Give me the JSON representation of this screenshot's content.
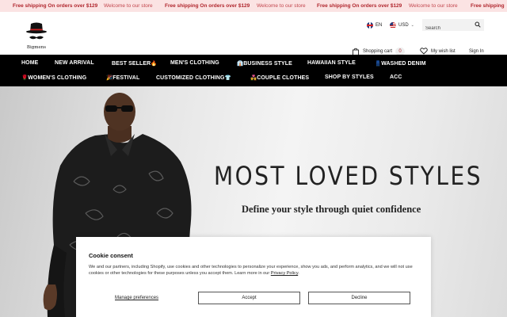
{
  "ticker": {
    "items": [
      {
        "text": "Free shipping On orders over $129",
        "style": "bold"
      },
      {
        "text": "Welcome to our store",
        "style": "light"
      },
      {
        "text": "Free shipping On orders over $129",
        "style": "bold"
      },
      {
        "text": "Welcome to our store",
        "style": "light"
      },
      {
        "text": "Free shipping On orders over $129",
        "style": "bold"
      },
      {
        "text": "Welcome to our store",
        "style": "light"
      },
      {
        "text": "Free shipping On orders over $129",
        "style": "bold"
      },
      {
        "text": "Welcome to our store",
        "style": "light"
      },
      {
        "text": "Free shipping",
        "style": "bold"
      }
    ]
  },
  "header": {
    "logo_text": "Bigmens",
    "language": "EN",
    "currency": "USD",
    "search_placeholder": "Search",
    "cart_label": "Shopping cart",
    "cart_count": "0",
    "wishlist_label": "My wish list",
    "signin_label": "Sign In"
  },
  "nav": {
    "row1": [
      {
        "label": "HOME",
        "emoji": ""
      },
      {
        "label": "NEW ARRIVAL",
        "emoji": ""
      },
      {
        "label": "BEST SELLER",
        "emoji": "🔥",
        "emoji_pos": "after"
      },
      {
        "label": "MEN'S CLOTHING",
        "emoji": ""
      },
      {
        "label": "BUSINESS STYLE",
        "emoji": "👔",
        "emoji_pos": "before"
      },
      {
        "label": "HAWAIIAN STYLE",
        "emoji": ""
      },
      {
        "label": "WASHED DENIM",
        "emoji": "👖",
        "emoji_pos": "before"
      }
    ],
    "row2": [
      {
        "label": "WOMEN'S CLOTHING",
        "emoji": "🌹",
        "emoji_pos": "before"
      },
      {
        "label": "FESTIVAL",
        "emoji": "🎉",
        "emoji_pos": "before"
      },
      {
        "label": "CUSTOMIZED CLOTHING",
        "emoji": "👕",
        "emoji_pos": "after"
      },
      {
        "label": "COUPLE CLOTHES",
        "emoji": "💑",
        "emoji_pos": "before"
      },
      {
        "label": "SHOP BY STYLES",
        "emoji": ""
      },
      {
        "label": "ACC",
        "emoji": ""
      }
    ]
  },
  "hero": {
    "title": "MOST LOVED STYLES",
    "subtitle": "Define your style through quiet confidence"
  },
  "cookie": {
    "title": "Cookie consent",
    "text": "We and our partners, including Shopify, use cookies and other technologies to personalize your experience, show you ads, and perform analytics, and we will not use cookies or other technologies for these purposes unless you accept them. Learn more in our ",
    "policy_link": "Privacy Policy",
    "policy_suffix": ".",
    "manage_label": "Manage preferences",
    "accept_label": "Accept",
    "decline_label": "Decline"
  },
  "colors": {
    "ticker_bg": "#fbe3e3",
    "ticker_accent": "#b0262d",
    "nav_bg": "#000000",
    "nav_text": "#ffffff"
  },
  "icons": [
    "hat-mustache-logo-icon",
    "flag-uk-icon",
    "flag-us-icon",
    "chevron-down-icon",
    "search-icon",
    "shopping-bag-icon",
    "heart-icon"
  ]
}
